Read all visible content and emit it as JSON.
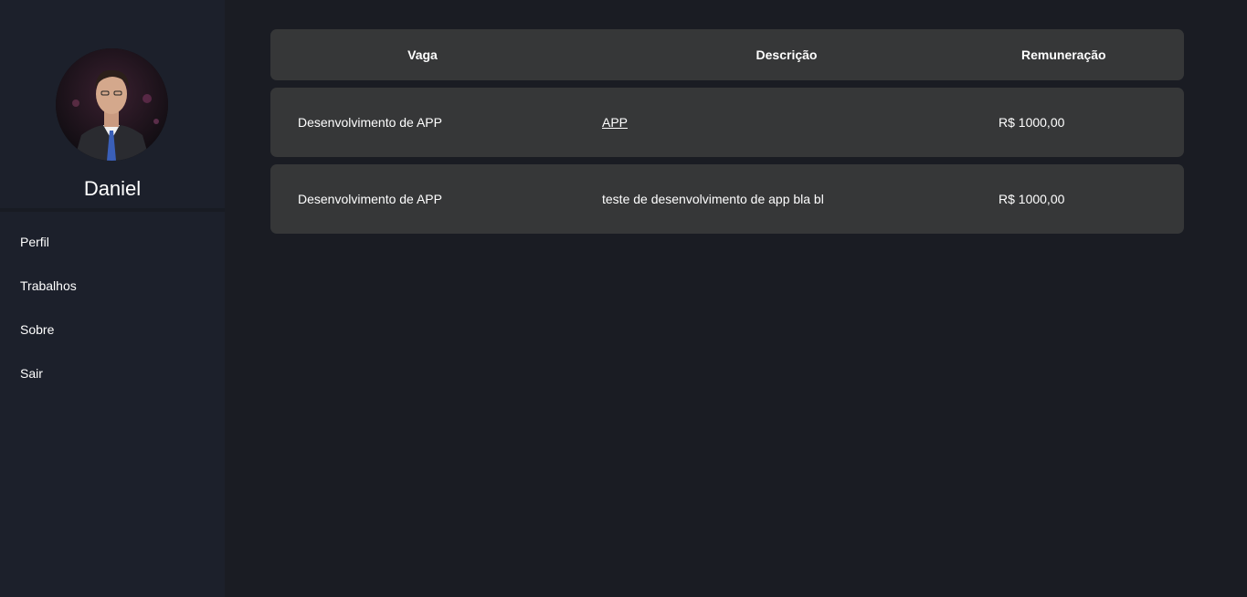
{
  "sidebar": {
    "user_name": "Daniel",
    "nav": [
      {
        "label": "Perfil"
      },
      {
        "label": "Trabalhos"
      },
      {
        "label": "Sobre"
      },
      {
        "label": "Sair"
      }
    ]
  },
  "table": {
    "headers": [
      "Vaga",
      "Descrição",
      "Remuneração"
    ],
    "rows": [
      {
        "vaga": "Desenvolvimento de APP",
        "descricao": "APP",
        "remuneracao": "R$ 1000,00"
      },
      {
        "vaga": "Desenvolvimento de APP",
        "descricao": "teste de desenvolvimento de app bla bl",
        "remuneracao": "R$ 1000,00"
      }
    ]
  },
  "colors": {
    "background": "#1a1c23",
    "sidebar": "#1c202b",
    "row": "#363738",
    "text": "#ffffff"
  }
}
